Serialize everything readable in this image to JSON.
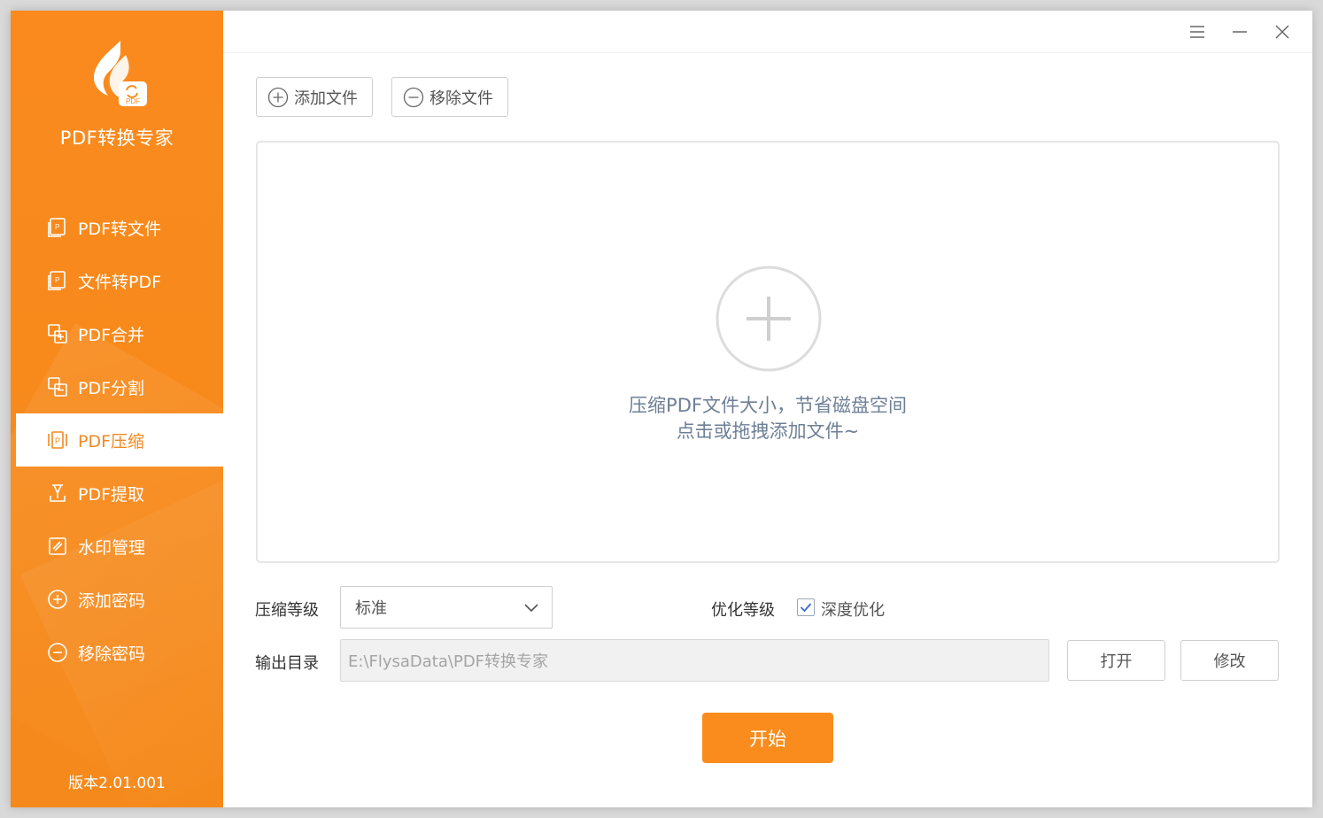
{
  "app": {
    "name": "PDF转换专家",
    "logo_badge": "PDF",
    "version": "版本2.01.001",
    "accent_color": "#f98c1c"
  },
  "sidebar": {
    "items": [
      {
        "label": "PDF转文件",
        "icon": "pdf-to-file-icon",
        "active": false
      },
      {
        "label": "文件转PDF",
        "icon": "file-to-pdf-icon",
        "active": false
      },
      {
        "label": "PDF合并",
        "icon": "merge-icon",
        "active": false
      },
      {
        "label": "PDF分割",
        "icon": "split-icon",
        "active": false
      },
      {
        "label": "PDF压缩",
        "icon": "compress-icon",
        "active": true
      },
      {
        "label": "PDF提取",
        "icon": "extract-icon",
        "active": false
      },
      {
        "label": "水印管理",
        "icon": "watermark-icon",
        "active": false
      },
      {
        "label": "添加密码",
        "icon": "add-password-icon",
        "active": false
      },
      {
        "label": "移除密码",
        "icon": "remove-password-icon",
        "active": false
      }
    ]
  },
  "toolbar": {
    "add_label": "添加文件",
    "remove_label": "移除文件"
  },
  "dropzone": {
    "line1": "压缩PDF文件大小，节省磁盘空间",
    "line2": "点击或拖拽添加文件~"
  },
  "settings": {
    "compress_level_label": "压缩等级",
    "compress_level_value": "标准",
    "optimize_label": "优化等级",
    "optimize_option_label": "深度优化",
    "optimize_checked": true,
    "output_label": "输出目录",
    "output_path": "E:\\FlysaData\\PDF转换专家",
    "open_label": "打开",
    "modify_label": "修改"
  },
  "start_label": "开始"
}
